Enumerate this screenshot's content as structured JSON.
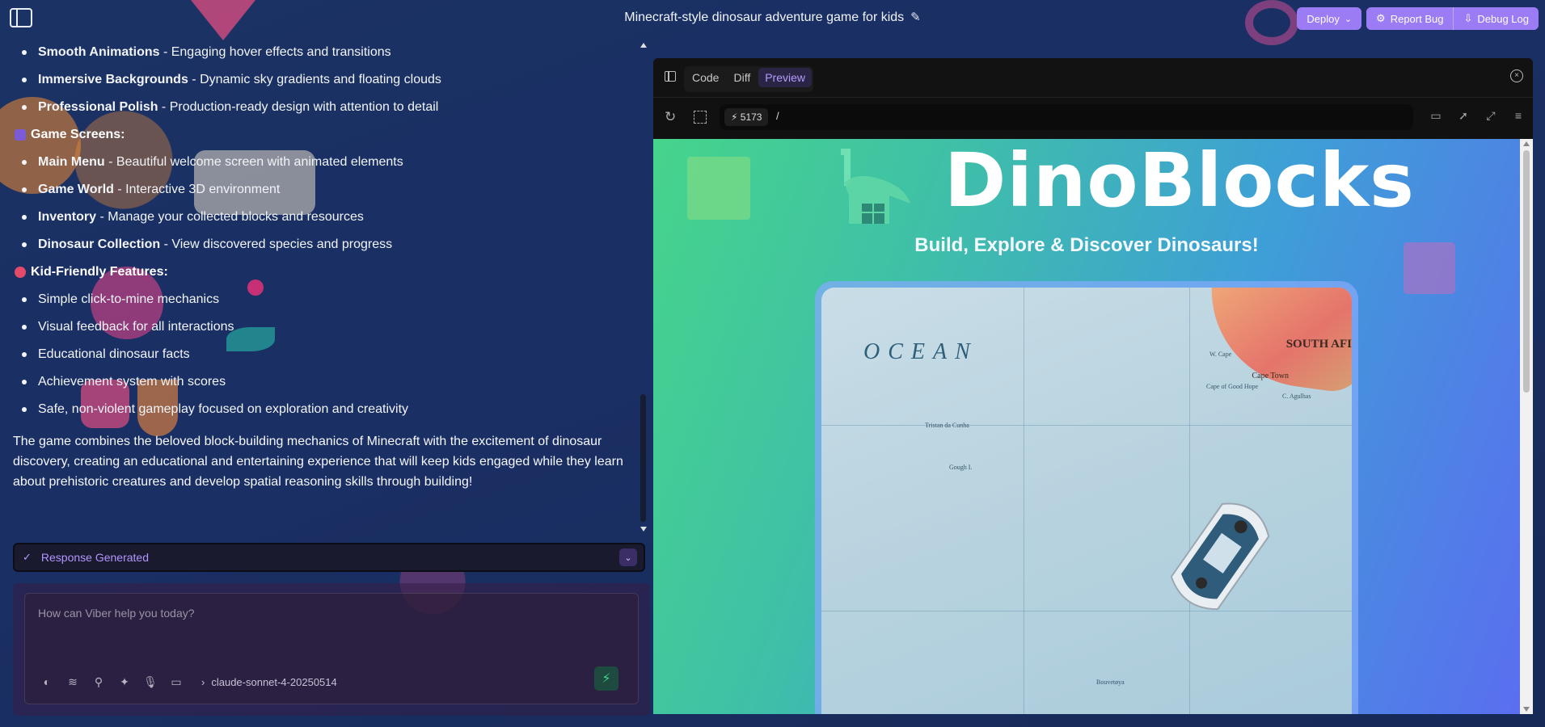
{
  "header": {
    "title": "Minecraft-style dinosaur adventure game for kids",
    "deploy_label": "Deploy",
    "report_bug_label": "Report Bug",
    "debug_log_label": "Debug Log"
  },
  "chat": {
    "top_items": [
      {
        "bold": "Smooth Animations",
        "text": " - Engaging hover effects and transitions"
      },
      {
        "bold": "Immersive Backgrounds",
        "text": " - Dynamic sky gradients and floating clouds"
      },
      {
        "bold": "Professional Polish",
        "text": " - Production-ready design with attention to detail"
      }
    ],
    "game_screens_heading": "Game Screens:",
    "game_screens": [
      {
        "bold": "Main Menu",
        "text": " - Beautiful welcome screen with animated elements"
      },
      {
        "bold": "Game World",
        "text": " - Interactive 3D environment"
      },
      {
        "bold": "Inventory",
        "text": " - Manage your collected blocks and resources"
      },
      {
        "bold": "Dinosaur Collection",
        "text": " - View discovered species and progress"
      }
    ],
    "kid_features_heading": "Kid-Friendly Features:",
    "kid_features": [
      "Simple click-to-mine mechanics",
      "Visual feedback for all interactions",
      "Educational dinosaur facts",
      "Achievement system with scores",
      "Safe, non-violent gameplay focused on exploration and creativity"
    ],
    "summary": "The game combines the beloved block-building mechanics of Minecraft with the excitement of dinosaur discovery, creating an educational and entertaining experience that will keep kids engaged while they learn about prehistoric creatures and develop spatial reasoning skills through building!",
    "response_status": "Response Generated"
  },
  "composer": {
    "placeholder": "How can Viber help you today?",
    "model": "claude-sonnet-4-20250514"
  },
  "preview": {
    "tabs": [
      "Code",
      "Diff",
      "Preview"
    ],
    "active_tab": "Preview",
    "port": "5173",
    "path": "/",
    "app": {
      "title": "DinoBlocks",
      "subtitle": "Build, Explore & Discover Dinosaurs!",
      "map_ocean": "OCEAN",
      "map_south_africa": "SOUTH AFI",
      "map_cape_town": "Cape Town",
      "map_labels": [
        "Tristan da Cunha",
        "Gough I.",
        "Bouvetøya",
        "W. Cape",
        "Cape of Good Hope",
        "C. Agulhas"
      ]
    }
  },
  "colors": {
    "accent_purple": "#9b7cf5",
    "response_text": "#b295ff",
    "send_green": "#3cd68f"
  }
}
